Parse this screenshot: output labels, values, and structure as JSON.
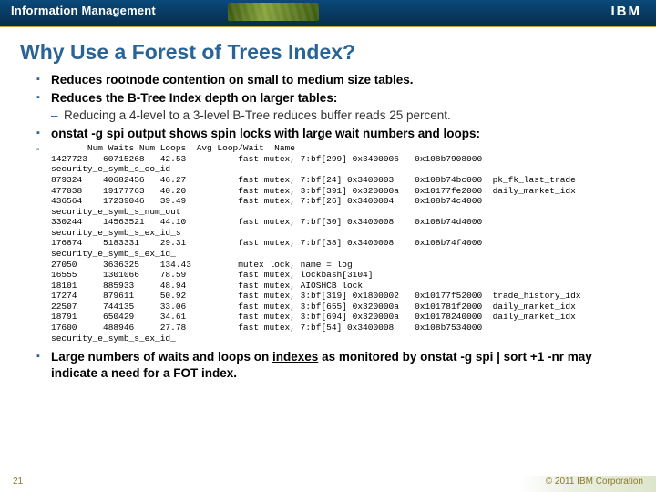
{
  "header": {
    "brand": "Information Management",
    "logo": "IBM"
  },
  "title": "Why Use a Forest of Trees Index?",
  "bullets": {
    "b1": "Reduces rootnode contention on small to medium size tables.",
    "b2": "Reduces the B-Tree Index depth on larger tables:",
    "b2_sub": "Reducing a 4-level to a 3-level B-Tree reduces buffer reads 25 percent.",
    "b3": "onstat -g spi output shows spin locks with large wait numbers and loops:",
    "b4_pre": "Large numbers of waits and loops on ",
    "b4_under": "indexes",
    "b4_post": " as monitored by onstat -g spi | sort +1 -nr may indicate a need for a FOT index."
  },
  "mono": "       Num Waits Num Loops  Avg Loop/Wait  Name\n1427723   60715268   42.53          fast mutex, 7:bf[299] 0x3400006   0x108b7908000\nsecurity_e_symb_s_co_id\n879324    40682456   46.27          fast mutex, 7:bf[24] 0x3400003    0x108b74bc000  pk_fk_last_trade\n477038    19177763   40.20          fast mutex, 3:bf[391] 0x320000a   0x10177fe2000  daily_market_idx\n436564    17239046   39.49          fast mutex, 7:bf[26] 0x3400004    0x108b74c4000\nsecurity_e_symb_s_num_out\n330244    14563521   44.10          fast mutex, 7:bf[30] 0x3400008    0x108b74d4000\nsecurity_e_symb_s_ex_id_s\n176874    5183331    29.31          fast mutex, 7:bf[38] 0x3400008    0x108b74f4000\nsecurity_e_symb_s_ex_id_\n27050     3636325    134.43         mutex lock, name = log\n16555     1301066    78.59          fast mutex, lockbash[3104]\n18101     885933     48.94          fast mutex, AIOSHCB lock\n17274     879611     50.92          fast mutex, 3:bf[319] 0x1800002   0x10177f52000  trade_history_idx\n22507     744135     33.06          fast mutex, 3:bf[655] 0x320000a   0x101781f2000  daily_market_idx\n18791     650429     34.61          fast mutex, 3:bf[694] 0x320000a   0x10178240000  daily_market_idx\n17600     488946     27.78          fast mutex, 7:bf[54] 0x3400008    0x108b7534000\nsecurity_e_symb_s_ex_id_",
  "footer": {
    "page": "21",
    "copyright": "© 2011 IBM Corporation"
  }
}
